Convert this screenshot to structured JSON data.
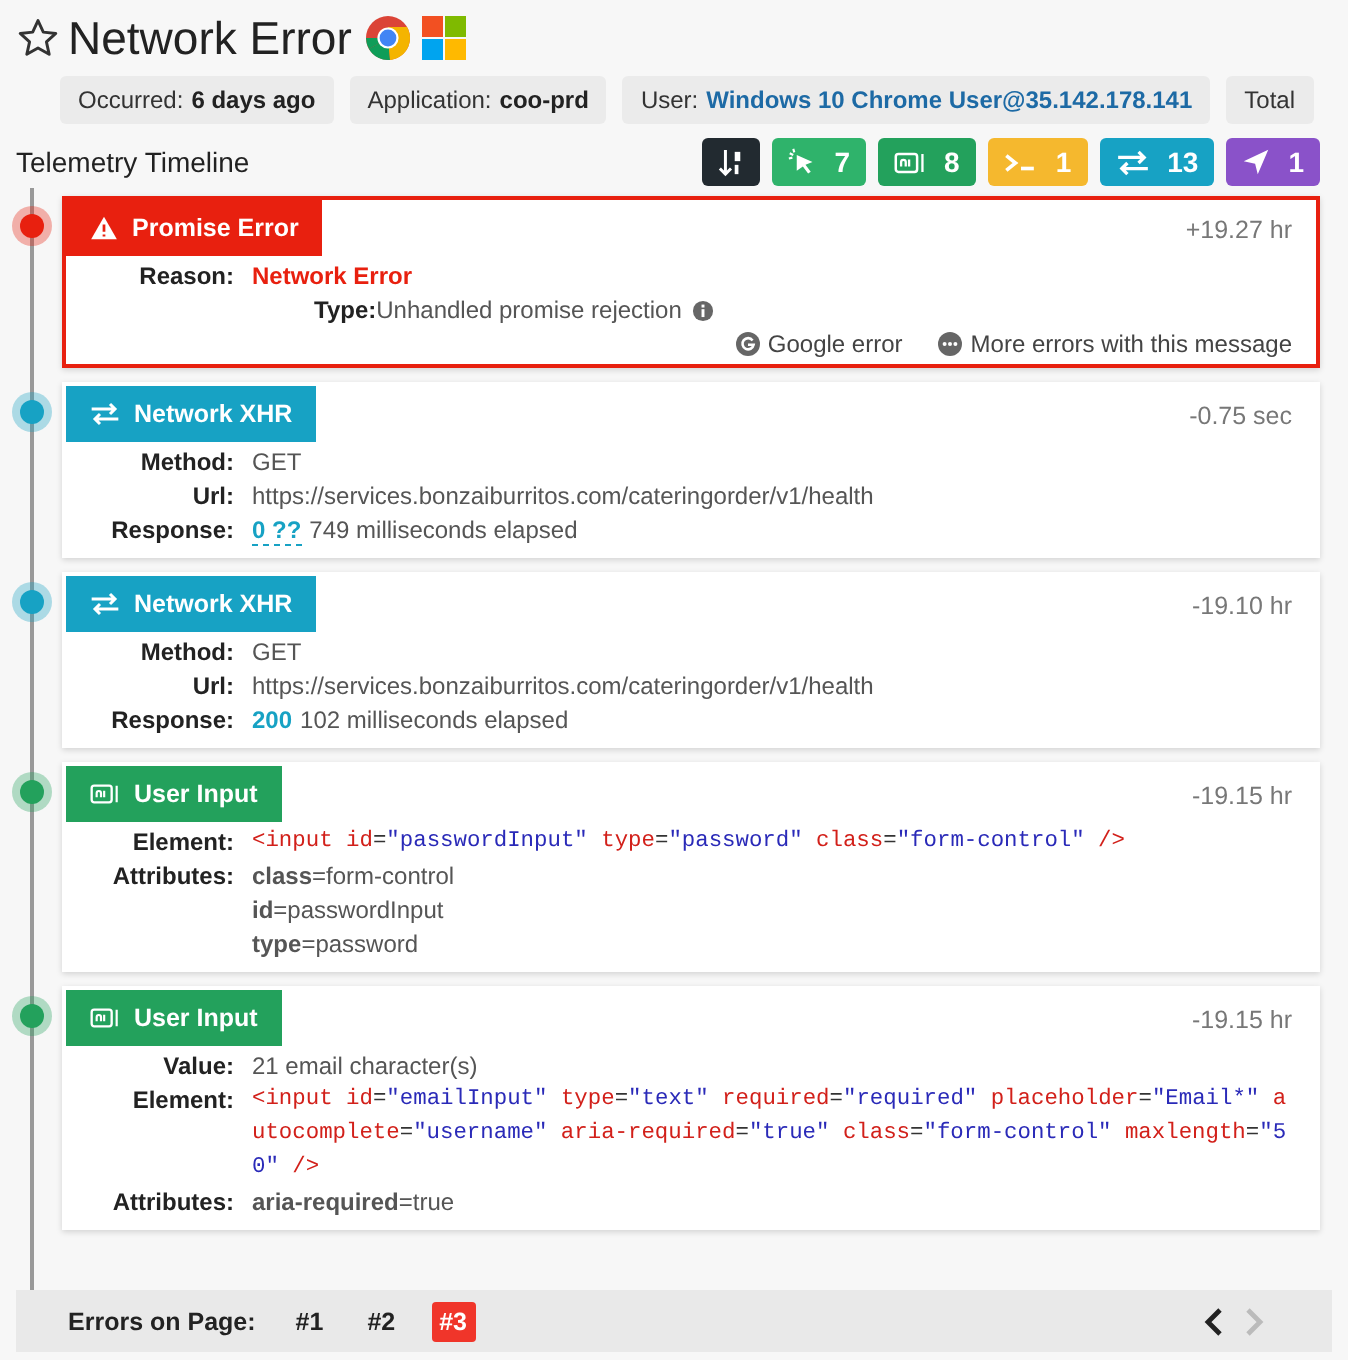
{
  "header": {
    "title": "Network Error"
  },
  "info": [
    {
      "label": "Occurred:",
      "value": "6 days ago",
      "kind": "plain"
    },
    {
      "label": "Application:",
      "value": "coo-prd",
      "kind": "plain"
    },
    {
      "label": "User:",
      "value": "Windows 10 Chrome User@35.142.178.141",
      "kind": "link"
    },
    {
      "label": "Total"
    }
  ],
  "timeline": {
    "title": "Telemetry Timeline",
    "filters": [
      {
        "kind": "sort"
      },
      {
        "kind": "click",
        "count": "7"
      },
      {
        "kind": "input",
        "count": "8"
      },
      {
        "kind": "console",
        "count": "1"
      },
      {
        "kind": "xhr",
        "count": "13"
      },
      {
        "kind": "navigation",
        "count": "1"
      }
    ],
    "events": [
      {
        "kind": "error",
        "label": "Promise Error",
        "time": "+19.27 hr",
        "selected": true,
        "fields": [
          {
            "label": "Reason:",
            "kind": "error",
            "value": "Network Error"
          },
          {
            "label": "Type:",
            "kind": "inline",
            "value": "Unhandled promise rejection"
          }
        ],
        "actions": [
          {
            "kind": "google",
            "label": "Google error"
          },
          {
            "kind": "more",
            "label": "More errors with this message"
          }
        ]
      },
      {
        "kind": "xhr",
        "label": "Network XHR",
        "time": "-0.75 sec",
        "selected": false,
        "fields": [
          {
            "label": "Method:",
            "kind": "text",
            "value": "GET"
          },
          {
            "label": "Url:",
            "kind": "text",
            "value": "https://services.bonzaiburritos.com/cateringorder/v1/health"
          },
          {
            "label": "Response:",
            "kind": "status-link",
            "code": "0 ??",
            "value": "749 milliseconds elapsed"
          }
        ]
      },
      {
        "kind": "xhr",
        "label": "Network XHR",
        "time": "-19.10 hr",
        "selected": false,
        "fields": [
          {
            "label": "Method:",
            "kind": "text",
            "value": "GET"
          },
          {
            "label": "Url:",
            "kind": "text",
            "value": "https://services.bonzaiburritos.com/cateringorder/v1/health"
          },
          {
            "label": "Response:",
            "kind": "status",
            "code": "200",
            "value": "102 milliseconds elapsed"
          }
        ]
      },
      {
        "kind": "input",
        "label": "User Input",
        "time": "-19.15 hr",
        "selected": false,
        "fields": [
          {
            "label": "Element:",
            "kind": "code",
            "tokens": [
              {
                "text": "<input",
                "kind": "tag"
              },
              {
                "text": " id",
                "kind": "attr"
              },
              {
                "text": "=",
                "kind": "plain"
              },
              {
                "text": "\"passwordInput\"",
                "kind": "value"
              },
              {
                "text": " type",
                "kind": "attr"
              },
              {
                "text": "=",
                "kind": "plain"
              },
              {
                "text": "\"password\"",
                "kind": "value"
              },
              {
                "text": " class",
                "kind": "attr"
              },
              {
                "text": "=",
                "kind": "plain"
              },
              {
                "text": "\"form-control\"",
                "kind": "value"
              },
              {
                "text": " />",
                "kind": "tag"
              }
            ]
          },
          {
            "label": "Attributes:",
            "kind": "attributes",
            "items": [
              {
                "name": "class",
                "value": "=form-control"
              },
              {
                "name": "id",
                "value": "=passwordInput"
              },
              {
                "name": "type",
                "value": "=password"
              }
            ]
          }
        ]
      },
      {
        "kind": "input",
        "label": "User Input",
        "time": "-19.15 hr",
        "selected": false,
        "fields": [
          {
            "label": "Value:",
            "kind": "text",
            "value": "21 email character(s)"
          },
          {
            "label": "Element:",
            "kind": "code",
            "tokens": [
              {
                "text": "<input",
                "kind": "tag"
              },
              {
                "text": " id",
                "kind": "attr"
              },
              {
                "text": "=",
                "kind": "plain"
              },
              {
                "text": "\"emailInput\"",
                "kind": "value"
              },
              {
                "text": " type",
                "kind": "attr"
              },
              {
                "text": "=",
                "kind": "plain"
              },
              {
                "text": "\"text\"",
                "kind": "value"
              },
              {
                "text": " required",
                "kind": "attr"
              },
              {
                "text": "=",
                "kind": "plain"
              },
              {
                "text": "\"required\"",
                "kind": "value"
              },
              {
                "text": " placeholder",
                "kind": "attr"
              },
              {
                "text": "=",
                "kind": "plain"
              },
              {
                "text": "\"Email*\"",
                "kind": "value"
              },
              {
                "text": " autocomplete",
                "kind": "attr"
              },
              {
                "text": "=",
                "kind": "plain"
              },
              {
                "text": "\"username\"",
                "kind": "value"
              },
              {
                "text": " aria-required",
                "kind": "attr"
              },
              {
                "text": "=",
                "kind": "plain"
              },
              {
                "text": "\"true\"",
                "kind": "value"
              },
              {
                "text": " class",
                "kind": "attr"
              },
              {
                "text": "=",
                "kind": "plain"
              },
              {
                "text": "\"form-control\"",
                "kind": "value"
              },
              {
                "text": " maxlength",
                "kind": "attr"
              },
              {
                "text": "=",
                "kind": "plain"
              },
              {
                "text": "\"50\"",
                "kind": "value"
              },
              {
                "text": " />",
                "kind": "tag"
              }
            ]
          },
          {
            "label": "Attributes:",
            "kind": "attributes",
            "items": [
              {
                "name": "aria-required",
                "value": "=true"
              }
            ]
          }
        ]
      }
    ]
  },
  "footer": {
    "label": "Errors on Page:",
    "pages": [
      {
        "label": "#1",
        "selected": false
      },
      {
        "label": "#2",
        "selected": false
      },
      {
        "label": "#3",
        "selected": true
      }
    ],
    "nav": [
      {
        "kind": "prev",
        "disabled": false
      },
      {
        "kind": "next",
        "disabled": true
      }
    ]
  }
}
